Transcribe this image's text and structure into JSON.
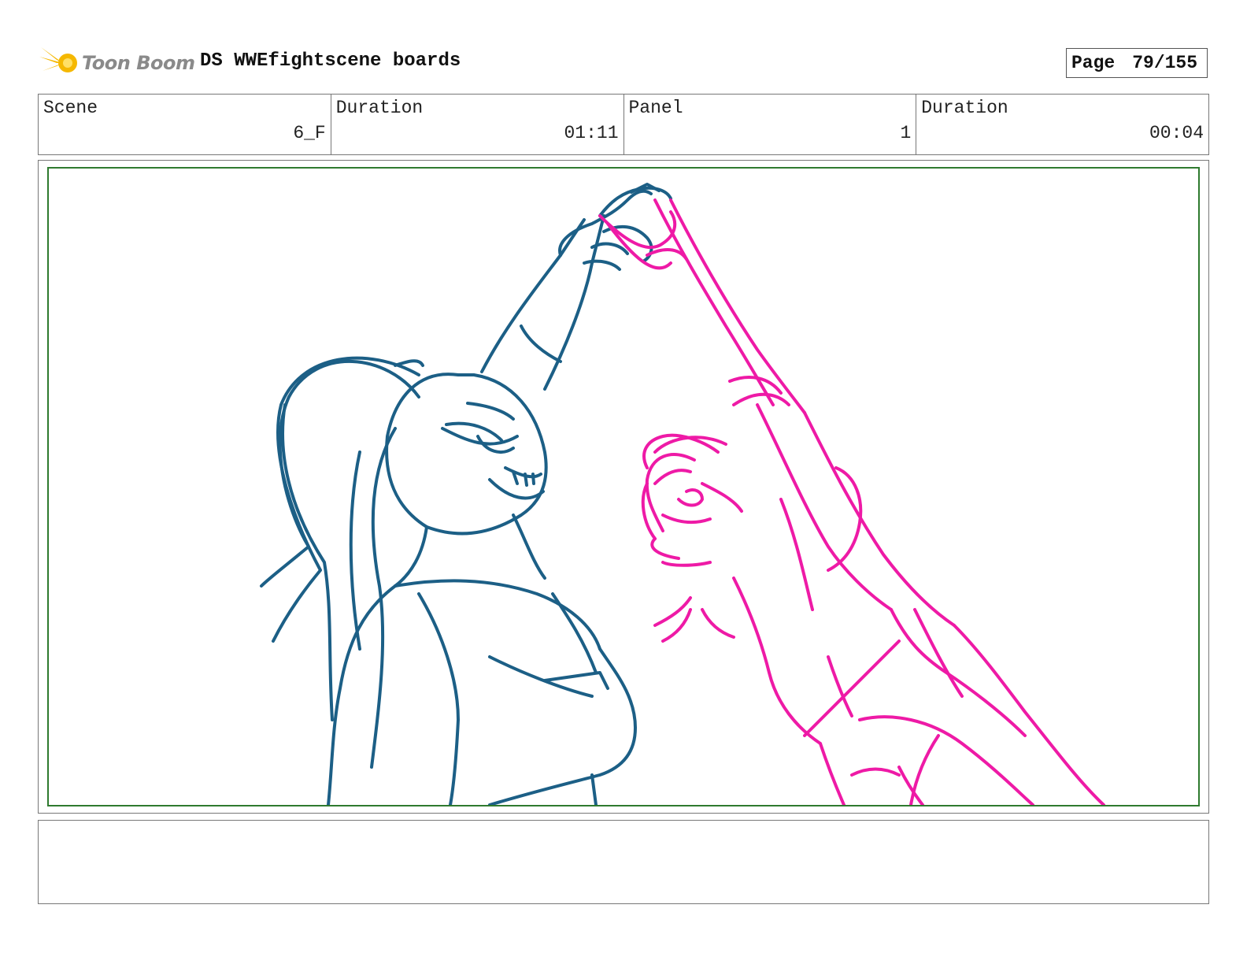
{
  "header": {
    "logo_text": "Toon Boom",
    "title": "DS WWEfightscene boards",
    "page_label": "Page",
    "page_value": "79/155"
  },
  "info": {
    "scene_label": "Scene",
    "scene_value": "6_F",
    "scene_duration_label": "Duration",
    "scene_duration_value": "01:11",
    "panel_label": "Panel",
    "panel_value": "1",
    "panel_duration_label": "Duration",
    "panel_duration_value": "00:04"
  },
  "notes": {
    "text": ""
  },
  "colors": {
    "logo_star": "#f5b800",
    "sketch_blue": "#1c5f86",
    "sketch_pink": "#ee1aa6",
    "frame_green": "#2f7a2f"
  },
  "icons": {
    "logo": "toon-boom-star-icon"
  }
}
